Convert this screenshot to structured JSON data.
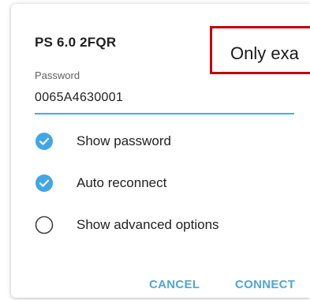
{
  "dialog": {
    "title": "PS 6.0 2FQR",
    "password_label": "Password",
    "password_value": "0065A4630001"
  },
  "options": [
    {
      "label": "Show password",
      "checked": true
    },
    {
      "label": "Auto reconnect",
      "checked": true
    },
    {
      "label": "Show advanced options",
      "checked": false
    }
  ],
  "buttons": {
    "cancel": "CANCEL",
    "connect": "CONNECT"
  },
  "callout": {
    "text": "Only exa"
  },
  "colors": {
    "accent": "#29b6f6",
    "checkbox": "#42a5e6",
    "button_text": "#4fa6d6",
    "callout_border": "#c00000"
  }
}
